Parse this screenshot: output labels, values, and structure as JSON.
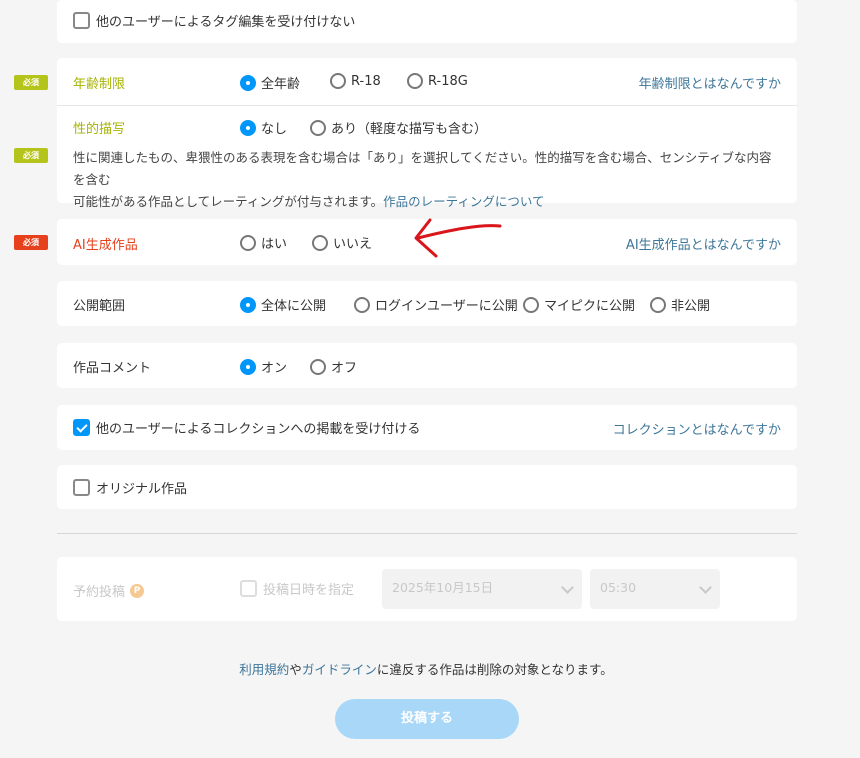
{
  "tag_edit": {
    "label": "他のユーザーによるタグ編集を受け付けない",
    "checked": false
  },
  "required_badge": "必須",
  "age_restriction": {
    "label": "年齢制限",
    "options": [
      "全年齢",
      "R-18",
      "R-18G"
    ],
    "selected": "全年齢",
    "help_link": "年齢制限とはなんですか"
  },
  "sexual_depiction": {
    "label": "性的描写",
    "options": [
      "なし",
      "あり（軽度な描写も含む）"
    ],
    "selected": "なし",
    "desc_line1": "性に関連したもの、卑猥性のある表現を含む場合は「あり」を選択してください。性的描写を含む場合、センシティブな内容を含む",
    "desc_line2": "可能性がある作品としてレーティングが付与されます。",
    "desc_link": "作品のレーティングについて"
  },
  "ai_generated": {
    "label": "AI生成作品",
    "options": [
      "はい",
      "いいえ"
    ],
    "selected": null,
    "help_link": "AI生成作品とはなんですか"
  },
  "visibility": {
    "label": "公開範囲",
    "options": [
      "全体に公開",
      "ログインユーザーに公開",
      "マイピクに公開",
      "非公開"
    ],
    "selected": "全体に公開"
  },
  "comments": {
    "label": "作品コメント",
    "options": [
      "オン",
      "オフ"
    ],
    "selected": "オン"
  },
  "collection": {
    "label": "他のユーザーによるコレクションへの掲載を受け付ける",
    "checked": true,
    "help_link": "コレクションとはなんですか"
  },
  "original": {
    "label": "オリジナル作品",
    "checked": false
  },
  "schedule": {
    "label": "予約投稿",
    "premium_badge": "P",
    "checkbox_label": "投稿日時を指定",
    "date": "2025年10月15日",
    "time": "05:30"
  },
  "notice": {
    "terms_link": "利用規約",
    "text1": "や",
    "guideline_link": "ガイドライン",
    "text2": "に違反する作品は削除の対象となります。"
  },
  "submit_label": "投稿する",
  "colors": {
    "accent": "#0096fa",
    "required_green": "#b5c41a",
    "required_red": "#e6401c",
    "link": "#3d7699"
  }
}
